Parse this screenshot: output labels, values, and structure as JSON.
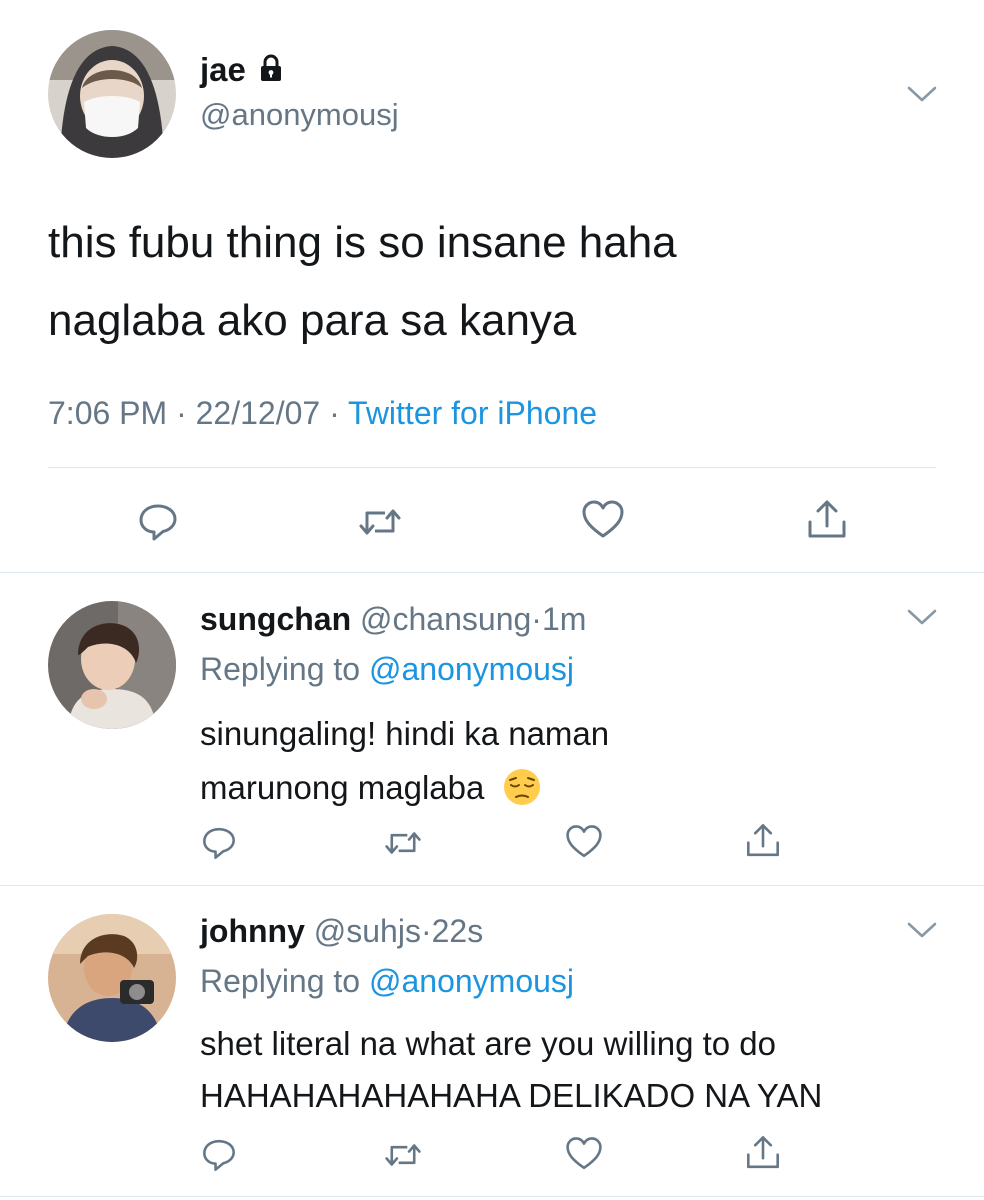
{
  "main_tweet": {
    "display_name": "jae",
    "handle": "@anonymousj",
    "text_lines": [
      "this fubu thing is so insane haha",
      "naglaba ako para sa kanya"
    ],
    "time": "7:06 PM",
    "date": "22/12/07",
    "source": "Twitter for iPhone",
    "separator": "·",
    "protected_icon": "lock-icon"
  },
  "replies": [
    {
      "display_name": "sungchan",
      "handle": "@chansung",
      "time": "1m",
      "replying_to_label": "Replying to",
      "replying_to_handle": "@anonymousj",
      "text_lines": [
        "sinungaling! hindi ka naman",
        "marunong maglaba"
      ],
      "emoji": "😔"
    },
    {
      "display_name": "johnny",
      "handle": "@suhjs",
      "time": "22s",
      "replying_to_label": "Replying to",
      "replying_to_handle": "@anonymousj",
      "text_lines": [
        "shet literal na what are you willing to do",
        "HAHAHAHAHAHAHA DELIKADO NA YAN"
      ]
    }
  ],
  "colors": {
    "text": "#14171a",
    "muted": "#657786",
    "link": "#1b95e0",
    "divider": "#e1e8ed"
  },
  "icons": [
    "reply-icon",
    "retweet-icon",
    "like-icon",
    "share-icon",
    "chevron-down-icon"
  ]
}
